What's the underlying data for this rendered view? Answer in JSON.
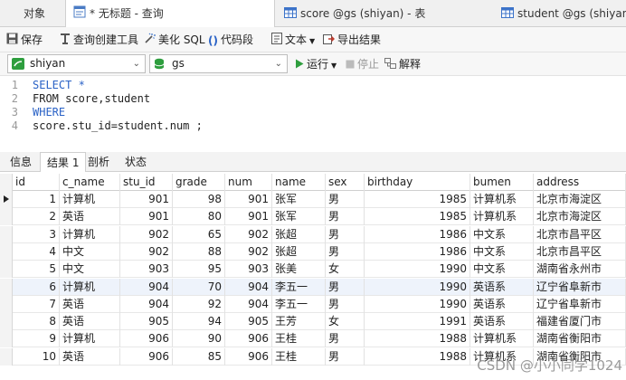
{
  "tabs": [
    {
      "label": "对象"
    },
    {
      "label": "* 无标题 - 查询"
    },
    {
      "label": "score @gs (shiyan) - 表"
    },
    {
      "label": "student @gs (shiyan) - 表"
    }
  ],
  "toolbar": {
    "save": "保存",
    "query_builder": "查询创建工具",
    "beautify_sql": "美化 SQL",
    "code_snippet": "代码段",
    "text": "文本",
    "export_results": "导出结果"
  },
  "connection": {
    "value": "shiyan"
  },
  "database": {
    "value": "gs"
  },
  "run": {
    "run_label": "运行",
    "stop_label": "停止",
    "explain_label": "解释"
  },
  "editor": {
    "lines": [
      {
        "no": "1",
        "text": "SELECT *"
      },
      {
        "no": "2",
        "text": "FROM score,student"
      },
      {
        "no": "3",
        "text": "WHERE"
      },
      {
        "no": "4",
        "text": "score.stu_id=student.num ;"
      }
    ]
  },
  "result_tabs": [
    "信息",
    "结果 1",
    "剖析",
    "状态"
  ],
  "grid": {
    "columns": [
      "id",
      "c_name",
      "stu_id",
      "grade",
      "num",
      "name",
      "sex",
      "birthday",
      "bumen",
      "address"
    ],
    "rows": [
      [
        "1",
        "计算机",
        "901",
        "98",
        "901",
        "张军",
        "男",
        "1985",
        "计算机系",
        "北京市海淀区"
      ],
      [
        "2",
        "英语",
        "901",
        "80",
        "901",
        "张军",
        "男",
        "1985",
        "计算机系",
        "北京市海淀区"
      ],
      [
        "3",
        "计算机",
        "902",
        "65",
        "902",
        "张超",
        "男",
        "1986",
        "中文系",
        "北京市昌平区"
      ],
      [
        "4",
        "中文",
        "902",
        "88",
        "902",
        "张超",
        "男",
        "1986",
        "中文系",
        "北京市昌平区"
      ],
      [
        "5",
        "中文",
        "903",
        "95",
        "903",
        "张美",
        "女",
        "1990",
        "中文系",
        "湖南省永州市"
      ],
      [
        "6",
        "计算机",
        "904",
        "70",
        "904",
        "李五一",
        "男",
        "1990",
        "英语系",
        "辽宁省阜新市"
      ],
      [
        "7",
        "英语",
        "904",
        "92",
        "904",
        "李五一",
        "男",
        "1990",
        "英语系",
        "辽宁省阜新市"
      ],
      [
        "8",
        "英语",
        "905",
        "94",
        "905",
        "王芳",
        "女",
        "1991",
        "英语系",
        "福建省厦门市"
      ],
      [
        "9",
        "计算机",
        "906",
        "90",
        "906",
        "王桂",
        "男",
        "1988",
        "计算机系",
        "湖南省衡阳市"
      ],
      [
        "10",
        "英语",
        "906",
        "85",
        "906",
        "王桂",
        "男",
        "1988",
        "计算机系",
        "湖南省衡阳市"
      ]
    ]
  },
  "watermark": "CSDN @小小同学1024",
  "colors": {
    "keyword": "#2a62c6",
    "run_green": "#2e9e3e",
    "selected_row": "#eef3fb"
  }
}
